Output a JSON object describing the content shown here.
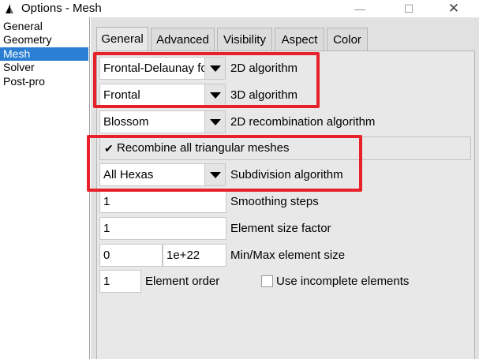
{
  "window": {
    "title": "Options - Mesh",
    "controls": {
      "minimize": "—",
      "maximize": "☐",
      "close": "✕"
    }
  },
  "tree": {
    "items": [
      "General",
      "Geometry",
      "Mesh",
      "Solver",
      "Post-pro"
    ],
    "selected": "Mesh"
  },
  "tabs": [
    "General",
    "Advanced",
    "Visibility",
    "Aspect",
    "Color"
  ],
  "active_tab": "General",
  "fields": {
    "algo2d": {
      "value": "Frontal-Delaunay for Quads",
      "label": "2D algorithm"
    },
    "algo3d": {
      "value": "Frontal",
      "label": "3D algorithm"
    },
    "recomb": {
      "value": "Blossom",
      "label": "2D recombination algorithm"
    },
    "recombine_all": {
      "label": "Recombine all triangular meshes",
      "checked": true,
      "mark": "✔"
    },
    "subdivision": {
      "value": "All Hexas",
      "label": "Subdivision algorithm"
    },
    "smoothing": {
      "value": "1",
      "label": "Smoothing steps"
    },
    "size_factor": {
      "value": "1",
      "label": "Element size factor"
    },
    "minmax": {
      "min": "0",
      "max": "1e+22",
      "label": "Min/Max element size"
    },
    "order": {
      "value": "1",
      "label": "Element order"
    },
    "incomplete": {
      "label": "Use incomplete elements",
      "checked": false
    }
  },
  "colors": {
    "highlight": "#e8202a",
    "selection": "#2a7ed3",
    "panel": "#e8e8e8"
  }
}
